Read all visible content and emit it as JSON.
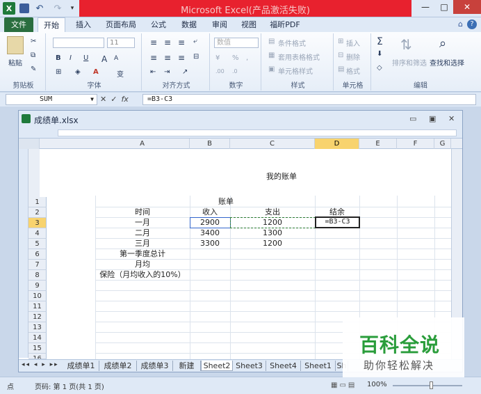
{
  "app": {
    "title": "Microsoft Excel(产品激活失败)",
    "window_controls": {
      "minimize": "—",
      "maximize": "□",
      "close": "✕"
    },
    "quick_access": {
      "logo": "X",
      "undo": "↶",
      "redo": "↷",
      "more": "▾"
    }
  },
  "ribbon_tabs": [
    "文件",
    "开始",
    "插入",
    "页面布局",
    "公式",
    "数据",
    "审阅",
    "视图",
    "福昕PDF"
  ],
  "ribbon_tab_icons": [
    "⌂",
    "?"
  ],
  "ribbon": {
    "clipboard": {
      "label": "剪贴板",
      "paste": "粘贴"
    },
    "font": {
      "label": "字体",
      "size": "11",
      "bold": "B",
      "italic": "I",
      "underline": "U",
      "grow": "A",
      "shrink": "A",
      "wen": "变"
    },
    "alignment": {
      "label": "对齐方式"
    },
    "number": {
      "label": "数字",
      "format": "数值",
      "percent": "%",
      "comma": ","
    },
    "styles": {
      "label": "样式",
      "conditional": "条件格式",
      "table": "套用表格格式",
      "cell_styles": "单元格样式"
    },
    "cells": {
      "label": "单元格",
      "insert": "插入",
      "delete": "删除",
      "format": "格式"
    },
    "editing": {
      "label": "编辑",
      "sum": "Σ",
      "sort_filter": "排序和筛选",
      "find_select": "查找和选择"
    }
  },
  "formula_bar": {
    "name_box": "SUM",
    "cancel": "✕",
    "enter": "✓",
    "fx": "fx",
    "formula": "=B3-C3"
  },
  "document": {
    "filename": "成绩单.xlsx",
    "columns": [
      "A",
      "B",
      "C",
      "D",
      "E",
      "F",
      "G"
    ],
    "selected_column": "D",
    "rows": [
      "1",
      "2",
      "3",
      "4",
      "5",
      "6",
      "7",
      "8",
      "9",
      "10",
      "11",
      "12",
      "13",
      "14",
      "15",
      "16"
    ],
    "selected_row": "3",
    "page_title": "我的账单",
    "cells": {
      "b1": "账单",
      "a2": "时间",
      "b2": "收入",
      "c2": "支出",
      "d2": "结余",
      "a3": "一月",
      "b3": "2900",
      "c3": "1200",
      "d3": "=B3-C3",
      "a4": "二月",
      "b4": "3400",
      "c4": "1300",
      "a5": "三月",
      "b5": "3300",
      "c5": "1200",
      "a6": "第一季度总计",
      "a7": "月均",
      "a8": "保险（月均收入的10%）"
    },
    "sheet_nav": "◂◂ ◂ ▸ ▸▸",
    "sheets": [
      "成绩单1",
      "成绩单2",
      "成绩单3",
      "新建",
      "Sheet2",
      "Sheet3",
      "Sheet4",
      "Sheet1",
      "Sh"
    ],
    "active_sheet": "Sheet2"
  },
  "status_bar": {
    "mode": "点",
    "page": "页码: 第 1 页(共 1 页)",
    "views": "▦▭▤",
    "zoom": "100%"
  },
  "watermark": {
    "title": "百科全说",
    "subtitle": "助你轻松解决"
  }
}
